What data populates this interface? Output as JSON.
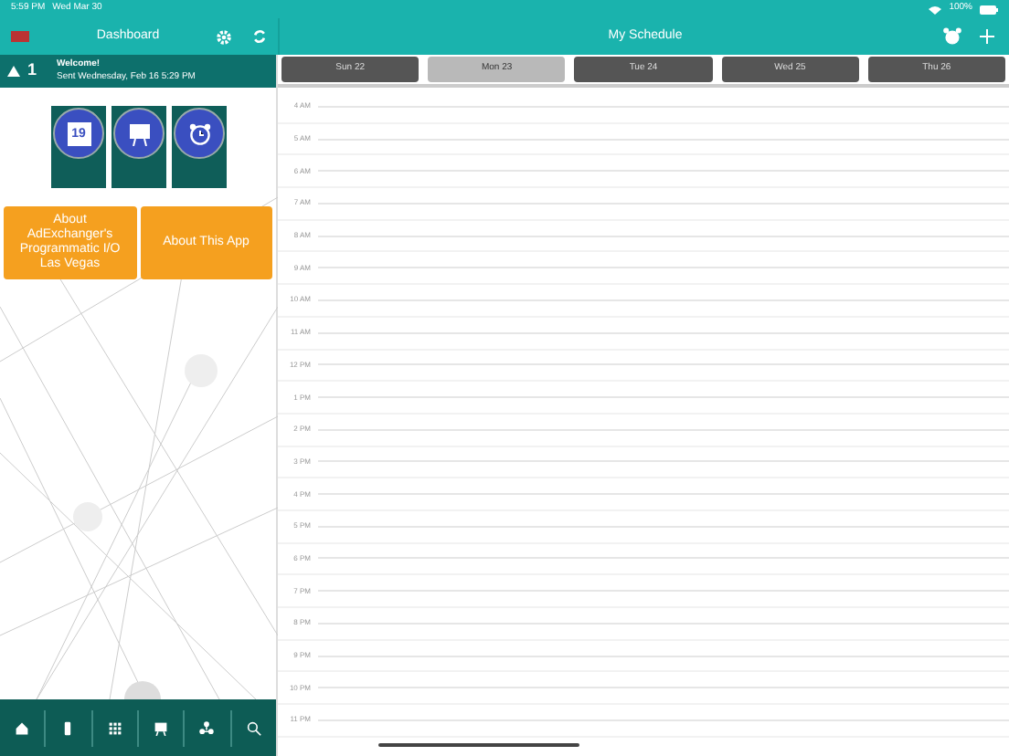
{
  "status_bar": {
    "time": "5:59 PM",
    "date": "Wed Mar 30",
    "battery": "100%"
  },
  "dashboard": {
    "title": "Dashboard",
    "notification": {
      "count": "1",
      "title": "Welcome!",
      "sent": "Sent Wednesday, Feb 16 5:29 PM"
    },
    "calendar_day": "19",
    "buttons": [
      "About AdExchanger's Programmatic I/O Las Vegas",
      "About This App"
    ],
    "nav": [
      {
        "kind": "home"
      },
      {
        "kind": "phone"
      },
      {
        "kind": "grid"
      },
      {
        "kind": "easel"
      },
      {
        "kind": "network"
      },
      {
        "kind": "search"
      }
    ]
  },
  "schedule": {
    "title": "My Schedule",
    "days": [
      {
        "label": "Sun 22",
        "selected": false
      },
      {
        "label": "Mon 23",
        "selected": true
      },
      {
        "label": "Tue 24",
        "selected": false
      },
      {
        "label": "Wed 25",
        "selected": false
      },
      {
        "label": "Thu 26",
        "selected": false
      }
    ],
    "hours": [
      "4 AM",
      "5 AM",
      "6 AM",
      "7 AM",
      "8 AM",
      "9 AM",
      "10 AM",
      "11 AM",
      "12 PM",
      "1 PM",
      "2 PM",
      "3 PM",
      "4 PM",
      "5 PM",
      "6 PM",
      "7 PM",
      "8 PM",
      "9 PM",
      "10 PM",
      "11 PM"
    ]
  }
}
